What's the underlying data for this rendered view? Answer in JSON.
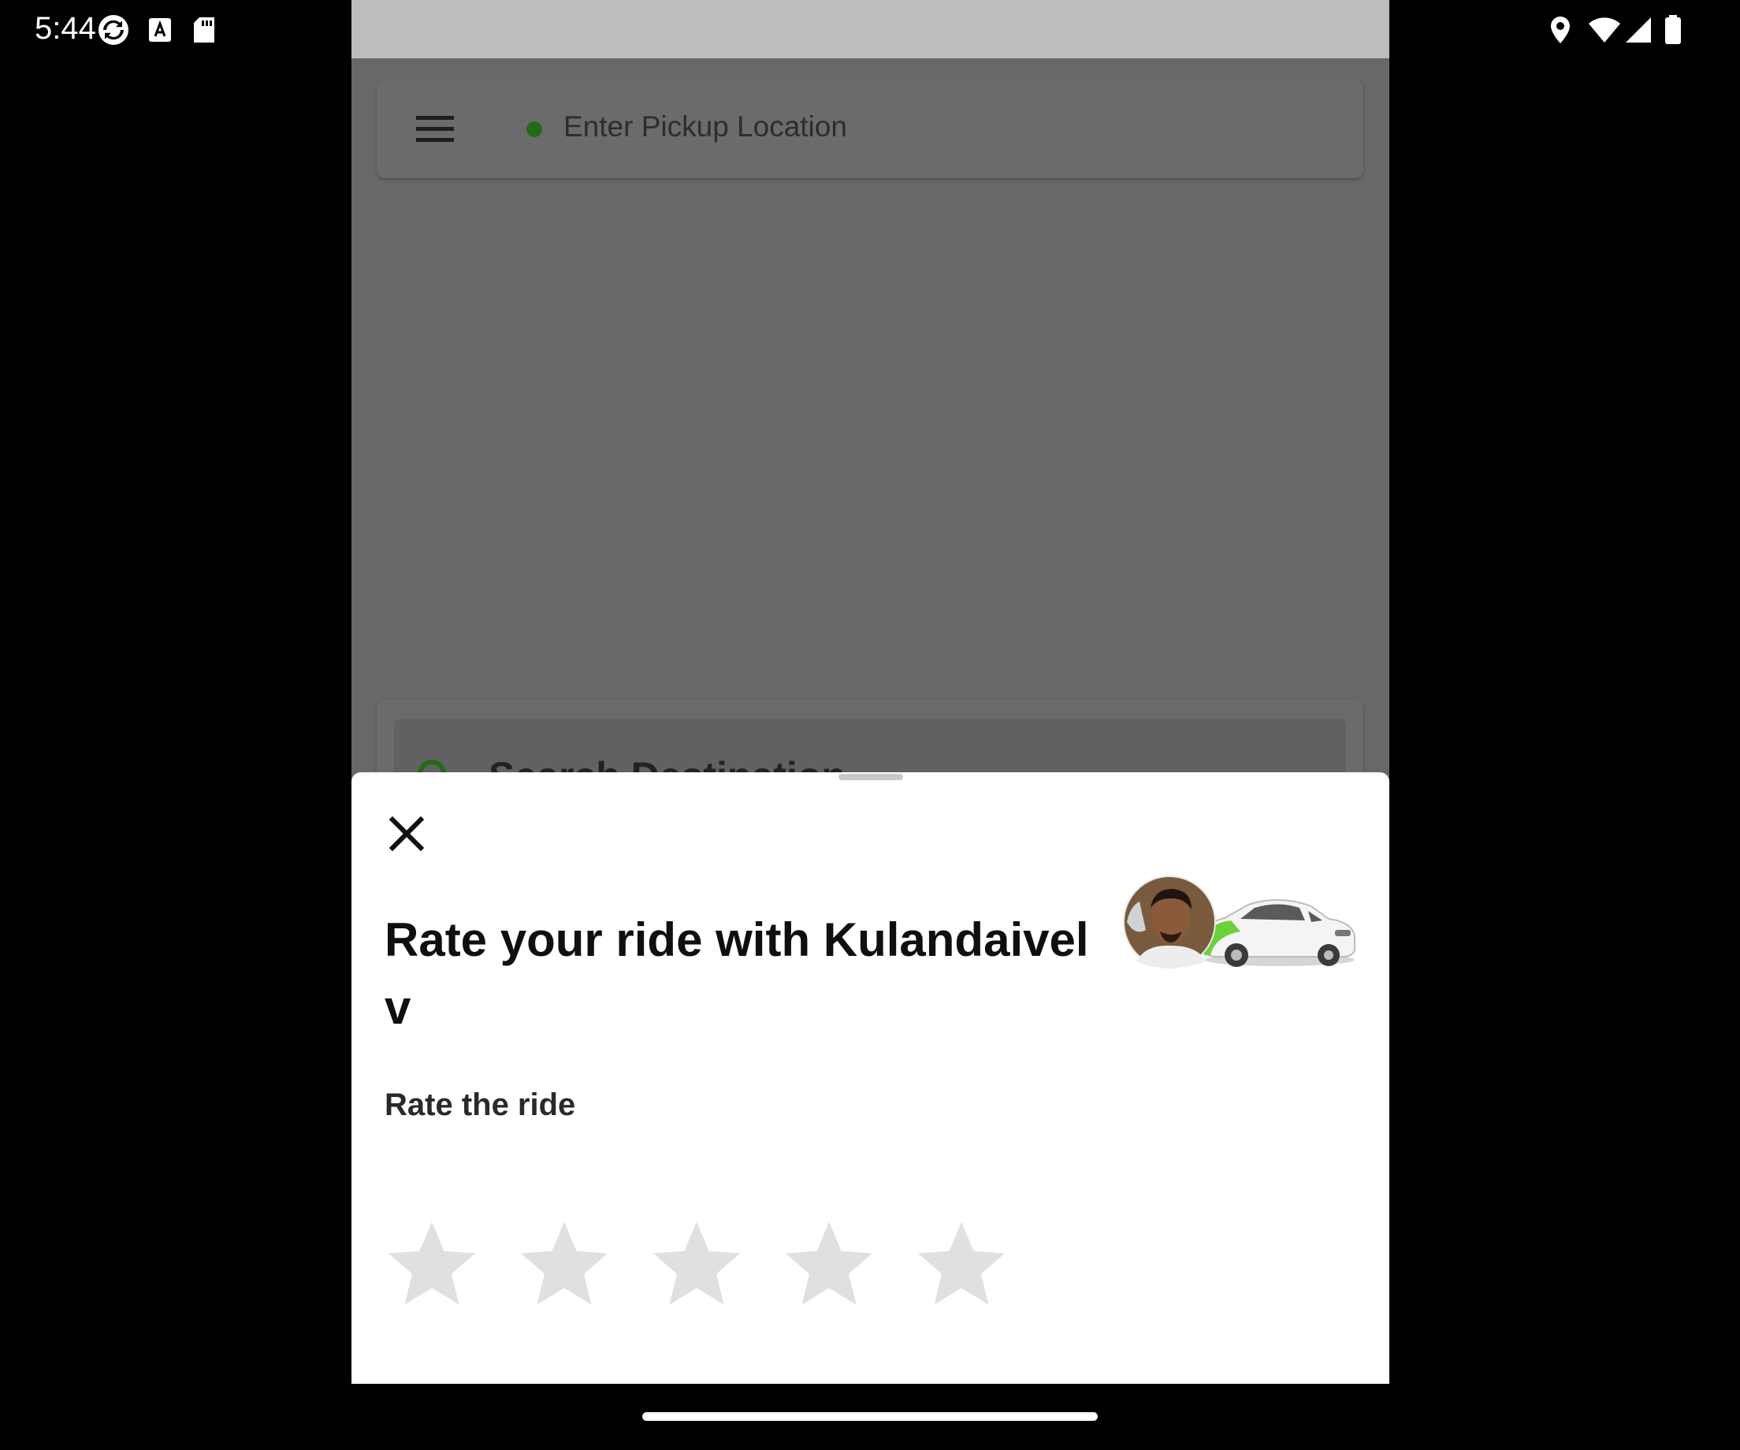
{
  "status_bar": {
    "time": "5:44"
  },
  "header": {
    "pickup_placeholder": "Enter Pickup Location"
  },
  "destination": {
    "label": "Search Destination"
  },
  "rating_sheet": {
    "title": "Rate your ride with Kulandaivel v",
    "rate_label": "Rate the ride",
    "rating": 0,
    "max_rating": 5
  },
  "colors": {
    "accent_green": "#1f6d12",
    "star_inactive": "#e0e0e0",
    "scrim": "#686868"
  },
  "icons": [
    "menu-icon",
    "search-icon",
    "close-icon",
    "star-icon",
    "driver-avatar",
    "car-image",
    "location-icon",
    "wifi-icon",
    "signal-icon",
    "battery-icon"
  ]
}
